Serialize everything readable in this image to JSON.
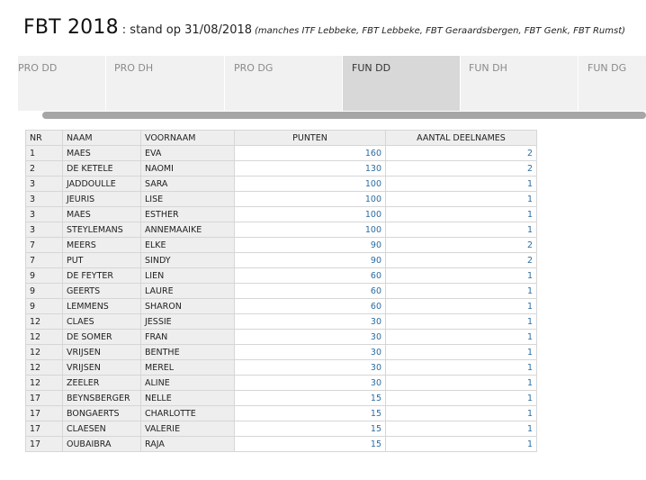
{
  "header": {
    "title": "FBT 2018",
    "stand": ": stand op 31/08/2018",
    "note": "(manches ITF Lebbeke, FBT Lebbeke, FBT Geraardsbergen, FBT Genk, FBT Rumst)"
  },
  "tabs": [
    {
      "label": "PRO DD",
      "active": false
    },
    {
      "label": "PRO DH",
      "active": false
    },
    {
      "label": "PRO DG",
      "active": false
    },
    {
      "label": "FUN DD",
      "active": true
    },
    {
      "label": "FUN DH",
      "active": false
    },
    {
      "label": "FUN DG",
      "active": false
    }
  ],
  "table": {
    "headers": [
      "NR",
      "NAAM",
      "VOORNAAM",
      "PUNTEN",
      "AANTAL DEELNAMES"
    ],
    "rows": [
      [
        "1",
        "MAES",
        "EVA",
        "160",
        "2"
      ],
      [
        "2",
        "DE KETELE",
        "NAOMI",
        "130",
        "2"
      ],
      [
        "3",
        "JADDOULLE",
        "SARA",
        "100",
        "1"
      ],
      [
        "3",
        "JEURIS",
        "LISE",
        "100",
        "1"
      ],
      [
        "3",
        "MAES",
        "ESTHER",
        "100",
        "1"
      ],
      [
        "3",
        "STEYLEMANS",
        "ANNEMAAIKE",
        "100",
        "1"
      ],
      [
        "7",
        "MEERS",
        "ELKE",
        "90",
        "2"
      ],
      [
        "7",
        "PUT",
        "SINDY",
        "90",
        "2"
      ],
      [
        "9",
        "DE FEYTER",
        "LIEN",
        "60",
        "1"
      ],
      [
        "9",
        "GEERTS",
        "LAURE",
        "60",
        "1"
      ],
      [
        "9",
        "LEMMENS",
        "SHARON",
        "60",
        "1"
      ],
      [
        "12",
        "CLAES",
        "JESSIE",
        "30",
        "1"
      ],
      [
        "12",
        "DE SOMER",
        "FRAN",
        "30",
        "1"
      ],
      [
        "12",
        "VRIJSEN",
        "BENTHE",
        "30",
        "1"
      ],
      [
        "12",
        "VRIJSEN",
        "MEREL",
        "30",
        "1"
      ],
      [
        "12",
        "ZEELER",
        "ALINE",
        "30",
        "1"
      ],
      [
        "17",
        "BEYNSBERGER",
        "NELLE",
        "15",
        "1"
      ],
      [
        "17",
        "BONGAERTS",
        "CHARLOTTE",
        "15",
        "1"
      ],
      [
        "17",
        "CLAESEN",
        "VALERIE",
        "15",
        "1"
      ],
      [
        "17",
        "OUBAIBRA",
        "RAJA",
        "15",
        "1"
      ]
    ]
  }
}
